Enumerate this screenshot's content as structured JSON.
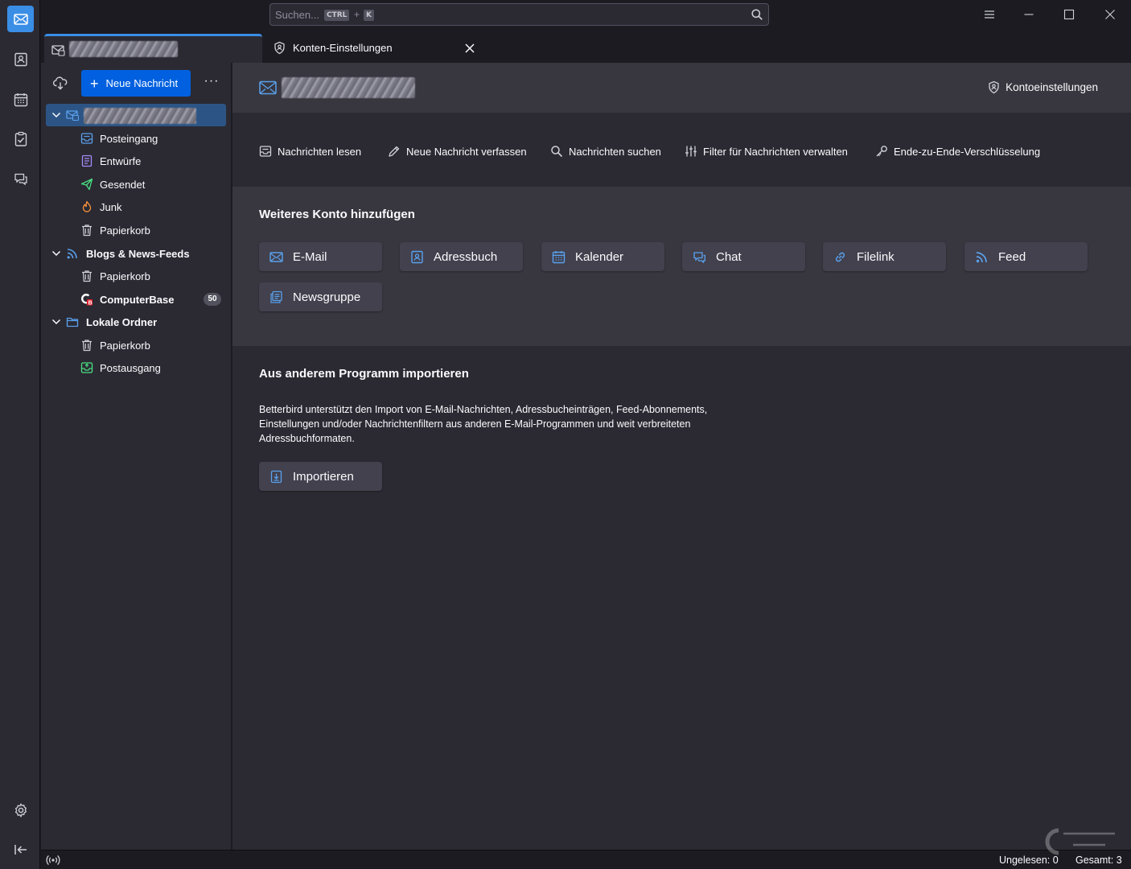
{
  "colors": {
    "accent": "#3a8ee6",
    "primary_button": "#0060df",
    "selection": "#2c5585",
    "icon_blue": "#5aa1ee"
  },
  "spaces": [
    {
      "name": "mail-icon",
      "active": true
    },
    {
      "name": "address-book-icon"
    },
    {
      "name": "calendar-icon"
    },
    {
      "name": "tasks-icon"
    },
    {
      "name": "chat-icon"
    },
    {
      "name": "settings-gear-icon"
    },
    {
      "name": "collapse-toolbar-icon"
    }
  ],
  "search": {
    "placeholder": "Suchen...",
    "kbd1": "CTRL",
    "plus": "+",
    "kbd2": "K"
  },
  "tabs": [
    {
      "label": "",
      "icon": "mail-tab-icon",
      "redacted": true
    },
    {
      "label": "Konten-Einstellungen",
      "icon": "account-settings-icon"
    }
  ],
  "folder_pane": {
    "new_message_label": "Neue Nachricht",
    "more_label": "···",
    "tree": [
      {
        "label": "",
        "redacted": true,
        "level": 0,
        "icon": "account-icon",
        "selected": true,
        "expanded": true
      },
      {
        "label": "Posteingang",
        "level": 1,
        "icon": "inbox-icon"
      },
      {
        "label": "Entwürfe",
        "level": 1,
        "icon": "drafts-icon"
      },
      {
        "label": "Gesendet",
        "level": 1,
        "icon": "sent-icon"
      },
      {
        "label": "Junk",
        "level": 1,
        "icon": "junk-icon"
      },
      {
        "label": "Papierkorb",
        "level": 1,
        "icon": "trash-icon"
      },
      {
        "label": "Blogs & News-Feeds",
        "level": 0,
        "icon": "rss-icon",
        "bold": true,
        "expanded": true
      },
      {
        "label": "Papierkorb",
        "level": 1,
        "icon": "trash-icon"
      },
      {
        "label": "ComputerBase",
        "level": 1,
        "icon": "computerbase-feed-icon",
        "bold": true,
        "badge": "50"
      },
      {
        "label": "Lokale Ordner",
        "level": 0,
        "icon": "folder-icon",
        "bold": true,
        "expanded": true
      },
      {
        "label": "Papierkorb",
        "level": 1,
        "icon": "trash-icon"
      },
      {
        "label": "Postausgang",
        "level": 1,
        "icon": "outbox-icon"
      }
    ]
  },
  "account_header": {
    "settings_link": "Kontoeinstellungen"
  },
  "actions": [
    {
      "label": "Nachrichten lesen",
      "icon": "read-messages-icon"
    },
    {
      "label": "Neue Nachricht verfassen",
      "icon": "compose-pencil-icon"
    },
    {
      "label": "Nachrichten suchen",
      "icon": "search-icon"
    },
    {
      "label": "Filter für Nachrichten verwalten",
      "icon": "filter-icon"
    },
    {
      "label": "Ende-zu-Ende-Verschlüsselung",
      "icon": "key-icon"
    }
  ],
  "add_account": {
    "title": "Weiteres Konto hinzufügen",
    "buttons": [
      {
        "label": "E-Mail",
        "icon": "email-icon"
      },
      {
        "label": "Adressbuch",
        "icon": "address-book-icon"
      },
      {
        "label": "Kalender",
        "icon": "calendar-icon"
      },
      {
        "label": "Chat",
        "icon": "chat-icon"
      },
      {
        "label": "Filelink",
        "icon": "link-icon"
      },
      {
        "label": "Feed",
        "icon": "rss-icon"
      },
      {
        "label": "Newsgruppe",
        "icon": "newsgroup-icon"
      }
    ]
  },
  "import": {
    "title": "Aus anderem Programm importieren",
    "description": "Betterbird unterstützt den Import von E-Mail-Nachrichten, Adressbucheinträgen, Feed-Abonnements, Einstellungen und/oder Nachrichtenfiltern aus anderen E-Mail-Programmen und weit verbreiteten Adressbuchformaten.",
    "button_label": "Importieren"
  },
  "status": {
    "unread": "Ungelesen: 0",
    "total": "Gesamt: 3"
  }
}
